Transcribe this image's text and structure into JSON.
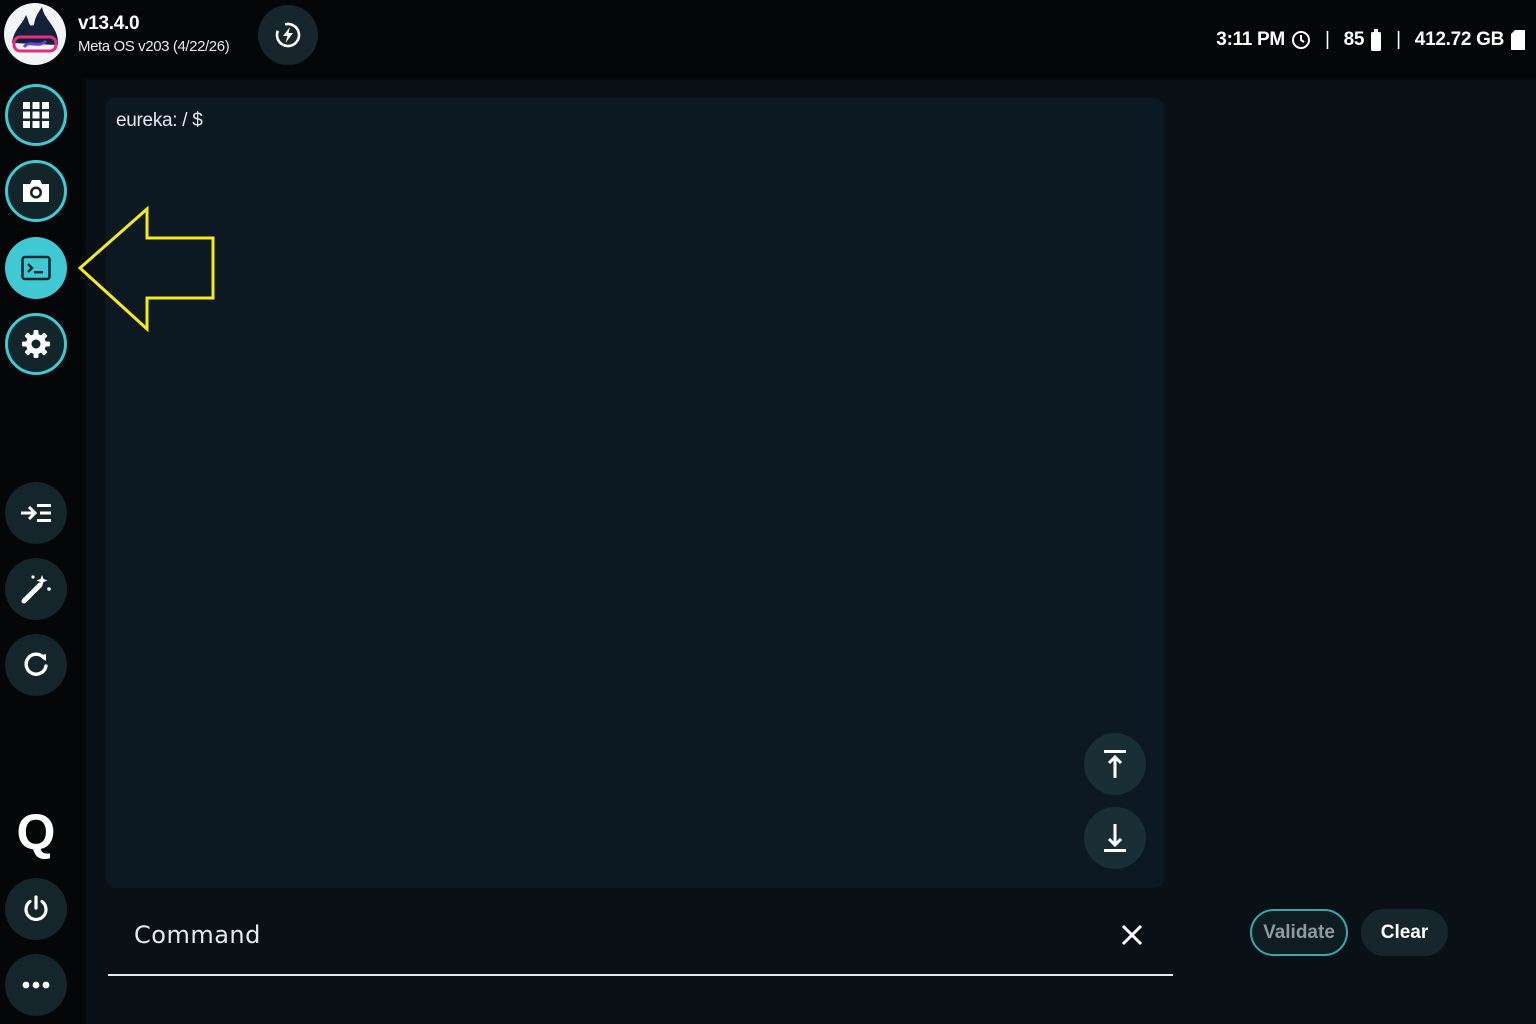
{
  "header": {
    "version": "v13.4.0",
    "os_build": "Meta OS v203 (4/22/26)"
  },
  "status": {
    "time": "3:11 PM",
    "separator": "|",
    "battery": "85",
    "storage": "412.72 GB"
  },
  "sidebar": {
    "items": [
      {
        "icon": "apps-grid-icon"
      },
      {
        "icon": "camera-icon"
      },
      {
        "icon": "terminal-icon",
        "active": true
      },
      {
        "icon": "gear-icon"
      },
      {
        "icon": "indent-icon"
      },
      {
        "icon": "magic-wand-icon"
      },
      {
        "icon": "refresh-icon"
      },
      {
        "icon": "q-logo-icon",
        "label": "Q"
      },
      {
        "icon": "power-icon"
      },
      {
        "icon": "more-icon"
      }
    ]
  },
  "terminal": {
    "prompt": "eureka: / $"
  },
  "command": {
    "placeholder": "Command"
  },
  "buttons": {
    "validate": "Validate",
    "clear": "Clear"
  },
  "colors": {
    "accent": "#41c9d3",
    "annotation": "#f5ea1e",
    "background": "#060a0d",
    "panel": "#0c1822"
  }
}
